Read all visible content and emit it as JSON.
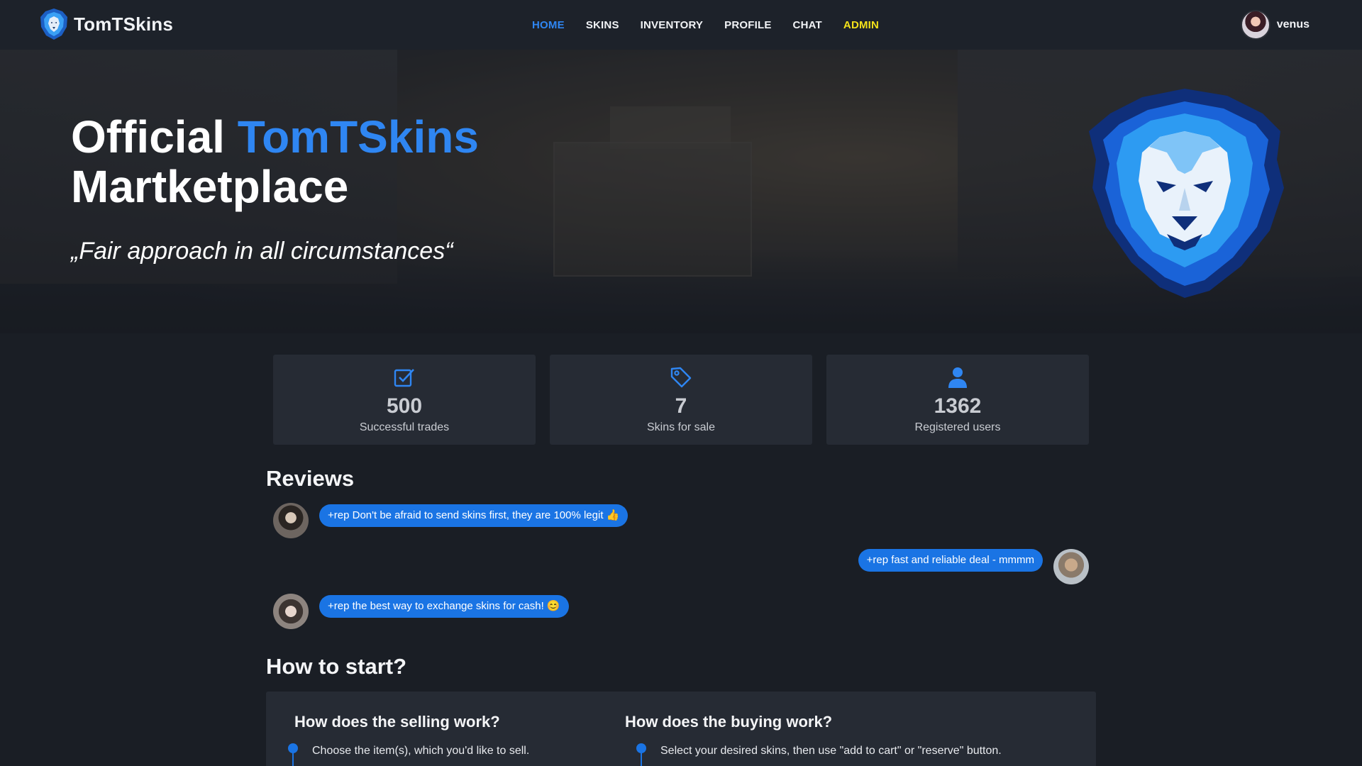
{
  "nav": {
    "brand": "TomTSkins",
    "links": [
      "HOME",
      "SKINS",
      "INVENTORY",
      "PROFILE",
      "CHAT",
      "ADMIN"
    ],
    "active": "HOME",
    "username": "venus"
  },
  "hero": {
    "title_prefix": "Official",
    "title_brand": "TomTSkins",
    "title_suffix": "Martketplace",
    "quote": "„Fair approach in all circumstances“"
  },
  "stats": [
    {
      "icon": "checkbox-icon",
      "value": "500",
      "label": "Successful trades"
    },
    {
      "icon": "tag-icon",
      "value": "7",
      "label": "Skins for sale"
    },
    {
      "icon": "user-icon",
      "value": "1362",
      "label": "Registered users"
    }
  ],
  "reviews": {
    "title": "Reviews",
    "items": [
      {
        "text": "+rep Don't be afraid to send skins first, they are 100% legit 👍",
        "side": "left"
      },
      {
        "text": "+rep fast and reliable deal - mmmm",
        "side": "right"
      },
      {
        "text": "+rep the best way to exchange skins for cash! 😊",
        "side": "left"
      }
    ]
  },
  "how": {
    "title": "How to start?",
    "selling_title": "How does the selling work?",
    "selling_step": "Choose the item(s), which you'd like to sell.",
    "buying_title": "How does the buying work?",
    "buying_step": "Select your desired skins, then use \"add to cart\" or \"reserve\" button."
  },
  "colors": {
    "accent": "#2f86f2",
    "admin": "#f3e11a",
    "bubble": "#1a74e4",
    "background": "#1a1e25",
    "card": "#262b34"
  }
}
